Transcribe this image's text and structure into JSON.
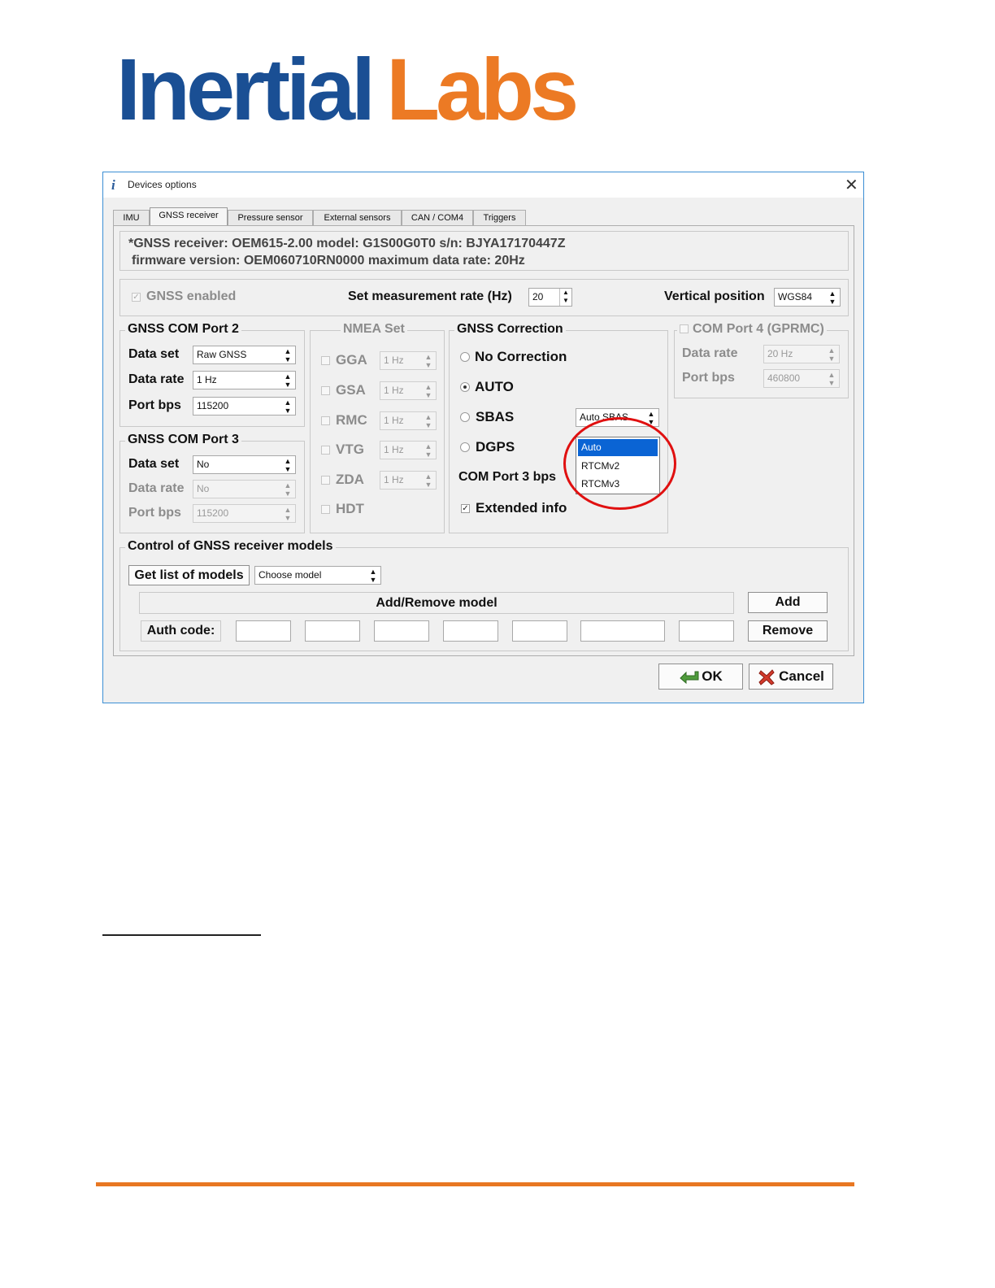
{
  "logo": {
    "word1": "Inertial",
    "word2": "Labs",
    "color1": "#1a4f94",
    "color2": "#ec7a24"
  },
  "window": {
    "title": "Devices options",
    "icon": "info-icon",
    "close_glyph": "✕"
  },
  "tabs": [
    {
      "label": "IMU"
    },
    {
      "label": "GNSS receiver",
      "active": true
    },
    {
      "label": "Pressure sensor"
    },
    {
      "label": "External sensors"
    },
    {
      "label": "CAN / COM4"
    },
    {
      "label": "Triggers"
    }
  ],
  "info": {
    "line1": "*GNSS receiver: OEM615-2.00 model: G1S00G0T0 s/n: BJYA17170447Z",
    "line2": "firmware version: OEM060710RN0000 maximum data rate: 20Hz"
  },
  "topbar": {
    "gnss_enabled": "GNSS enabled",
    "rate_label": "Set measurement rate (Hz)",
    "rate_value": "20",
    "vpos_label": "Vertical position",
    "vpos_value": "WGS84"
  },
  "port2": {
    "legend": "GNSS COM Port 2",
    "rows": [
      {
        "label": "Data set",
        "value": "Raw GNSS"
      },
      {
        "label": "Data rate",
        "value": "1 Hz"
      },
      {
        "label": "Port bps",
        "value": "115200"
      }
    ]
  },
  "port3": {
    "legend": "GNSS COM Port 3",
    "rows": [
      {
        "label": "Data set",
        "value": "No"
      },
      {
        "label": "Data rate",
        "value": "No"
      },
      {
        "label": "Port bps",
        "value": "115200"
      }
    ]
  },
  "nmea": {
    "legend": "NMEA Set",
    "items": [
      {
        "label": "GGA",
        "rate": "1 Hz"
      },
      {
        "label": "GSA",
        "rate": "1 Hz"
      },
      {
        "label": "RMC",
        "rate": "1 Hz"
      },
      {
        "label": "VTG",
        "rate": "1 Hz"
      },
      {
        "label": "ZDA",
        "rate": "1 Hz"
      },
      {
        "label": "HDT"
      }
    ]
  },
  "correction": {
    "legend": "GNSS Correction",
    "no_correction": "No Correction",
    "auto": "AUTO",
    "sbas": "SBAS",
    "sbas_value": "Auto SBAS",
    "dgps": "DGPS",
    "com3_bps": "COM Port 3 bps",
    "extended": "Extended info",
    "dropdown_items": [
      "Auto",
      "RTCMv2",
      "RTCMv3"
    ],
    "selected": "AUTO"
  },
  "port4": {
    "legend": "COM Port 4 (GPRMC)",
    "rows": [
      {
        "label": "Data rate",
        "value": "20 Hz"
      },
      {
        "label": "Port bps",
        "value": "460800"
      }
    ]
  },
  "models": {
    "legend": "Control of GNSS receiver models",
    "get_list": "Get list of models",
    "choose": "Choose model",
    "add_remove": "Add/Remove model",
    "add": "Add",
    "auth_label": "Auth code:",
    "remove": "Remove"
  },
  "footer": {
    "ok": "OK",
    "cancel": "Cancel"
  },
  "colors": {
    "accent_bar": "#e87722",
    "highlight_circle": "#e01010",
    "selection": "#0a64d4"
  }
}
